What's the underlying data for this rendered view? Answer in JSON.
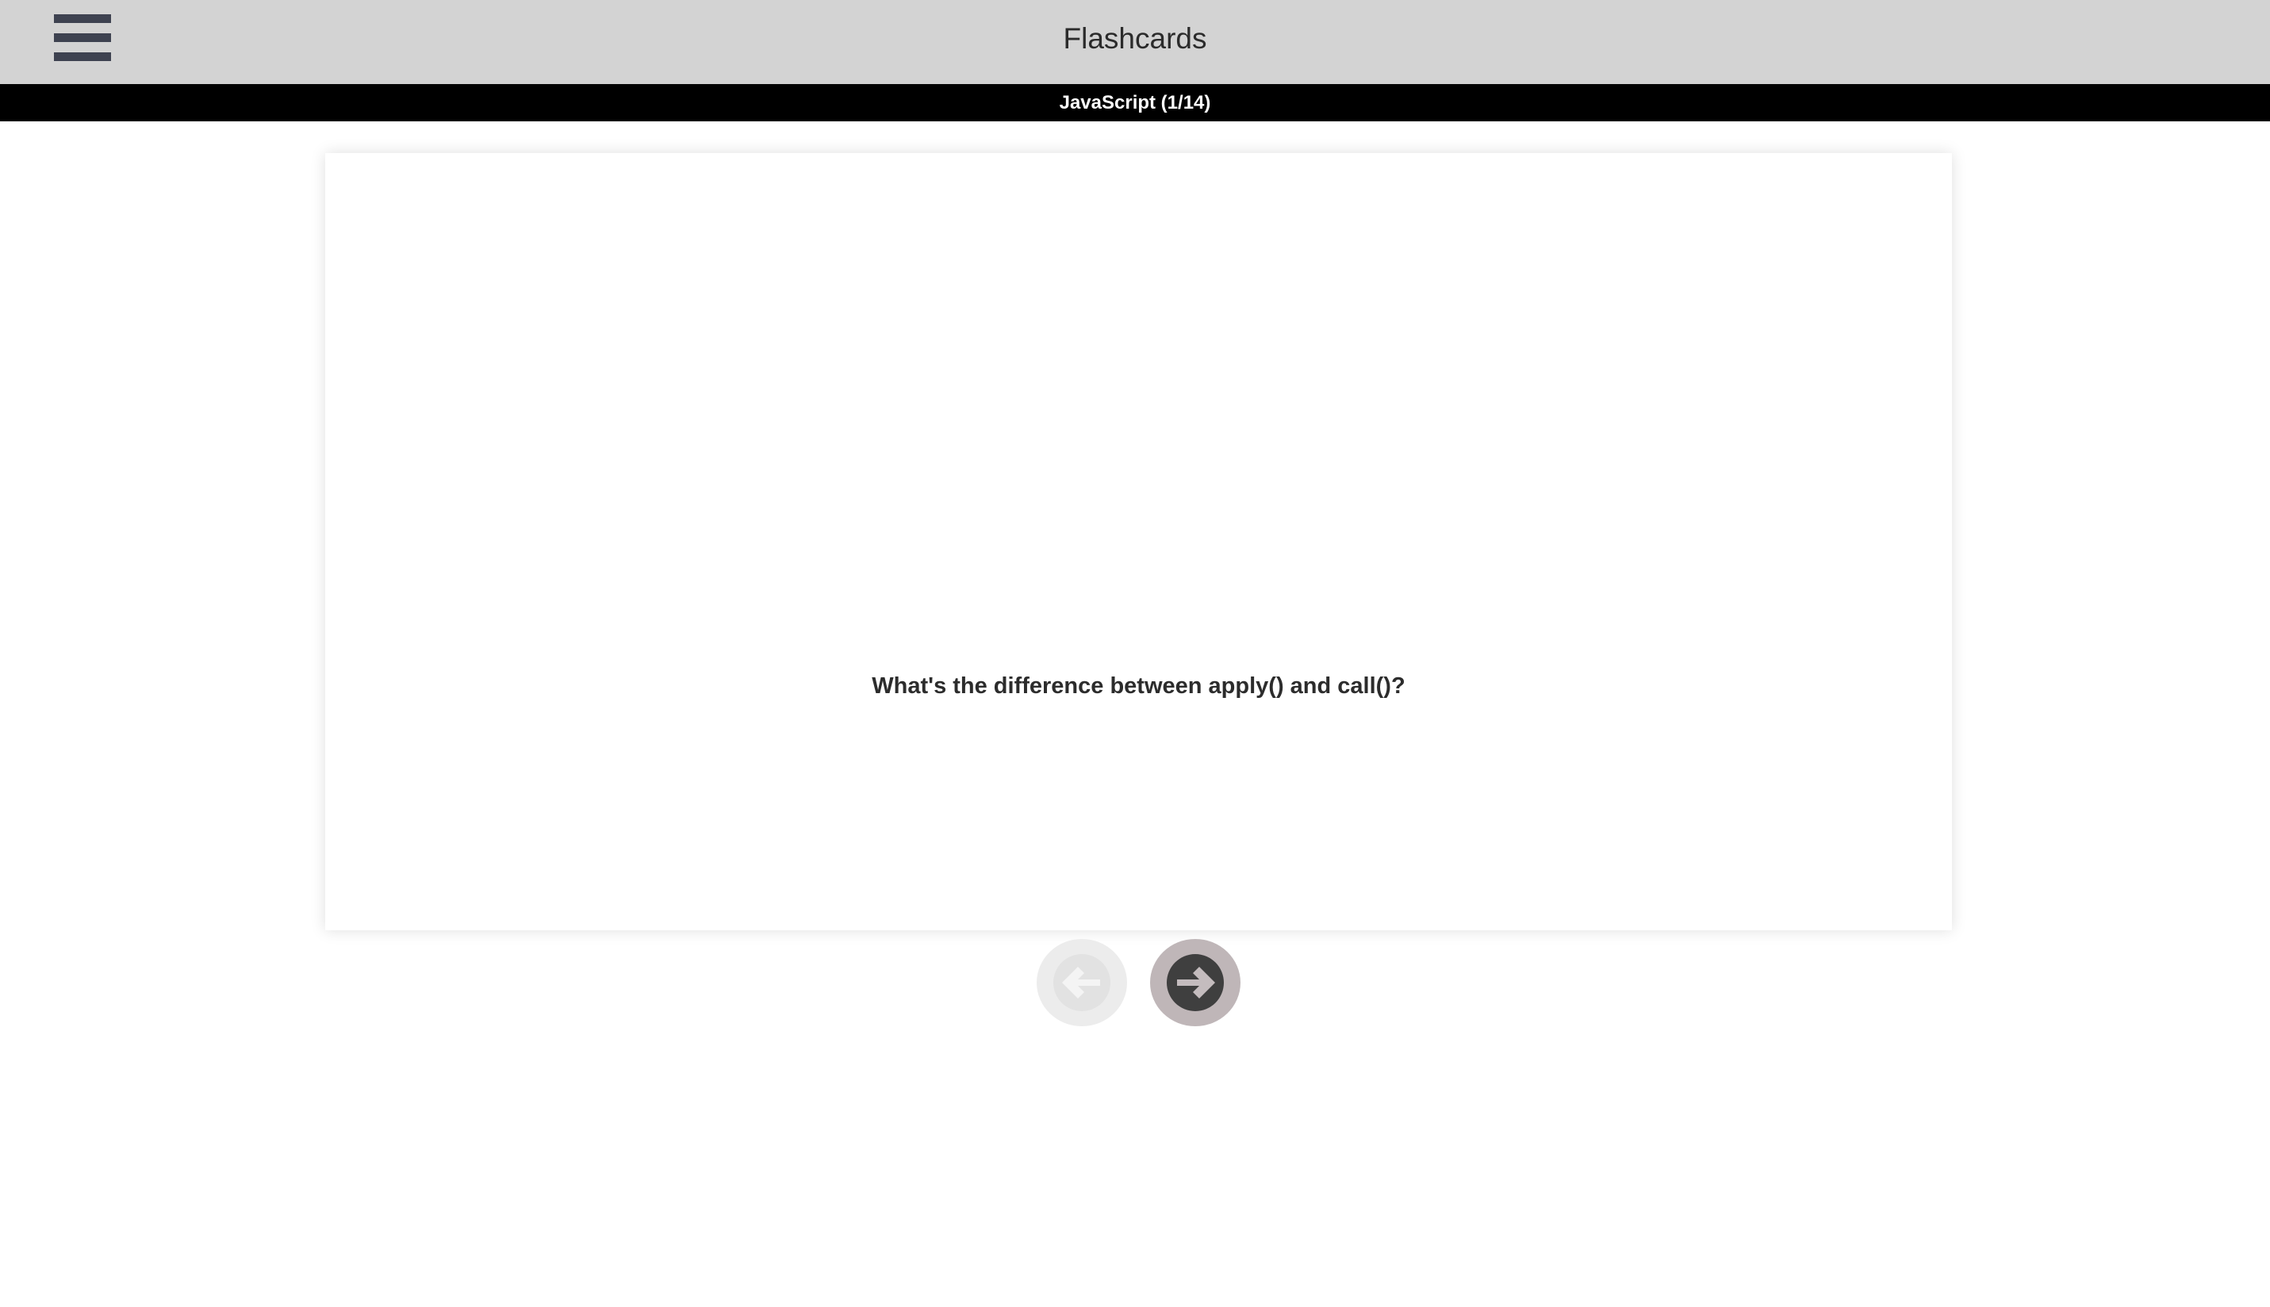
{
  "header": {
    "title": "Flashcards",
    "menu_icon": "hamburger-menu-icon"
  },
  "deck": {
    "label": "JavaScript (1/14)"
  },
  "card": {
    "question": "What's the difference between apply() and call()?"
  },
  "navigation": {
    "prev_icon": "arrow-left-circle-icon",
    "next_icon": "arrow-right-circle-icon",
    "prev_enabled": false,
    "next_enabled": true
  },
  "colors": {
    "topbar_bg": "#d3d3d3",
    "deckbar_bg": "#000000",
    "menu_icon": "#3e4250",
    "next_btn_bg": "#bfb6b8",
    "next_arrow": "#3f3f3f",
    "prev_btn_bg": "#ececec",
    "prev_arrow": "#e2e2e2"
  }
}
